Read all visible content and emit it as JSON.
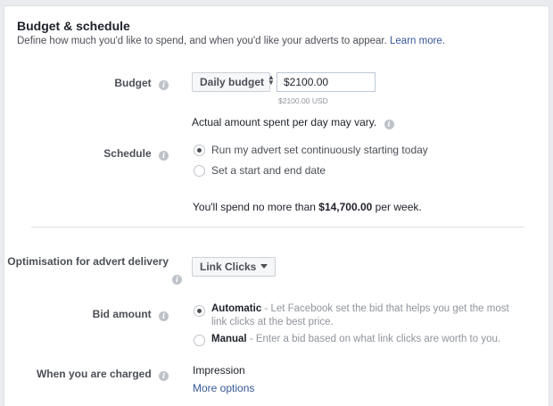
{
  "header": {
    "title": "Budget & schedule",
    "subtitle": "Define how much you'd like to spend, and when you'd like your adverts to appear.",
    "learn_more": "Learn more."
  },
  "budget": {
    "label": "Budget",
    "type_selector": "Daily budget",
    "amount_value": "$2100.00",
    "amount_hint": "$2100.00 USD",
    "note": "Actual amount spent per day may vary."
  },
  "schedule": {
    "label": "Schedule",
    "options": [
      {
        "label": "Run my advert set continuously starting today",
        "selected": true
      },
      {
        "label": "Set a start and end date",
        "selected": false
      }
    ],
    "spend_prefix": "You'll spend no more than ",
    "spend_amount": "$14,700.00",
    "spend_suffix": " per week."
  },
  "optimisation": {
    "label": "Optimisation for advert delivery",
    "value": "Link Clicks"
  },
  "bid": {
    "label": "Bid amount",
    "options": [
      {
        "title": "Automatic",
        "desc_line1": " - Let Facebook set the bid that helps you get the most",
        "desc_line2": "link clicks at the best price.",
        "selected": true
      },
      {
        "title": "Manual",
        "desc_line1": " - Enter a bid based on what link clicks are worth to you.",
        "selected": false
      }
    ]
  },
  "charged": {
    "label": "When you are charged",
    "value": "Impression",
    "more_options": "More options"
  },
  "colors": {
    "link": "#365899",
    "label": "#4b4f56",
    "muted": "#90949c",
    "divider": "#dddfe2"
  }
}
